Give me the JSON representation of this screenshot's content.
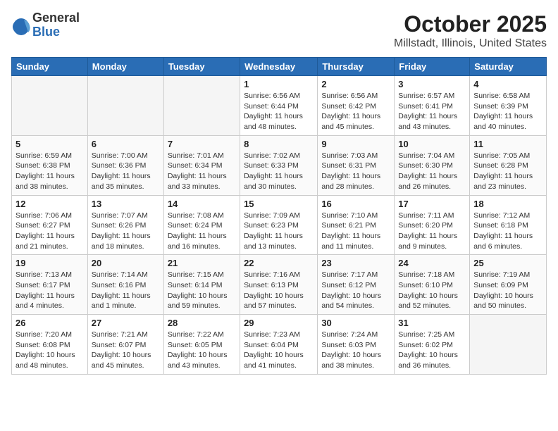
{
  "logo": {
    "general": "General",
    "blue": "Blue"
  },
  "title": "October 2025",
  "location": "Millstadt, Illinois, United States",
  "days_of_week": [
    "Sunday",
    "Monday",
    "Tuesday",
    "Wednesday",
    "Thursday",
    "Friday",
    "Saturday"
  ],
  "weeks": [
    [
      {
        "day": "",
        "info": ""
      },
      {
        "day": "",
        "info": ""
      },
      {
        "day": "",
        "info": ""
      },
      {
        "day": "1",
        "info": "Sunrise: 6:56 AM\nSunset: 6:44 PM\nDaylight: 11 hours\nand 48 minutes."
      },
      {
        "day": "2",
        "info": "Sunrise: 6:56 AM\nSunset: 6:42 PM\nDaylight: 11 hours\nand 45 minutes."
      },
      {
        "day": "3",
        "info": "Sunrise: 6:57 AM\nSunset: 6:41 PM\nDaylight: 11 hours\nand 43 minutes."
      },
      {
        "day": "4",
        "info": "Sunrise: 6:58 AM\nSunset: 6:39 PM\nDaylight: 11 hours\nand 40 minutes."
      }
    ],
    [
      {
        "day": "5",
        "info": "Sunrise: 6:59 AM\nSunset: 6:38 PM\nDaylight: 11 hours\nand 38 minutes."
      },
      {
        "day": "6",
        "info": "Sunrise: 7:00 AM\nSunset: 6:36 PM\nDaylight: 11 hours\nand 35 minutes."
      },
      {
        "day": "7",
        "info": "Sunrise: 7:01 AM\nSunset: 6:34 PM\nDaylight: 11 hours\nand 33 minutes."
      },
      {
        "day": "8",
        "info": "Sunrise: 7:02 AM\nSunset: 6:33 PM\nDaylight: 11 hours\nand 30 minutes."
      },
      {
        "day": "9",
        "info": "Sunrise: 7:03 AM\nSunset: 6:31 PM\nDaylight: 11 hours\nand 28 minutes."
      },
      {
        "day": "10",
        "info": "Sunrise: 7:04 AM\nSunset: 6:30 PM\nDaylight: 11 hours\nand 26 minutes."
      },
      {
        "day": "11",
        "info": "Sunrise: 7:05 AM\nSunset: 6:28 PM\nDaylight: 11 hours\nand 23 minutes."
      }
    ],
    [
      {
        "day": "12",
        "info": "Sunrise: 7:06 AM\nSunset: 6:27 PM\nDaylight: 11 hours\nand 21 minutes."
      },
      {
        "day": "13",
        "info": "Sunrise: 7:07 AM\nSunset: 6:26 PM\nDaylight: 11 hours\nand 18 minutes."
      },
      {
        "day": "14",
        "info": "Sunrise: 7:08 AM\nSunset: 6:24 PM\nDaylight: 11 hours\nand 16 minutes."
      },
      {
        "day": "15",
        "info": "Sunrise: 7:09 AM\nSunset: 6:23 PM\nDaylight: 11 hours\nand 13 minutes."
      },
      {
        "day": "16",
        "info": "Sunrise: 7:10 AM\nSunset: 6:21 PM\nDaylight: 11 hours\nand 11 minutes."
      },
      {
        "day": "17",
        "info": "Sunrise: 7:11 AM\nSunset: 6:20 PM\nDaylight: 11 hours\nand 9 minutes."
      },
      {
        "day": "18",
        "info": "Sunrise: 7:12 AM\nSunset: 6:18 PM\nDaylight: 11 hours\nand 6 minutes."
      }
    ],
    [
      {
        "day": "19",
        "info": "Sunrise: 7:13 AM\nSunset: 6:17 PM\nDaylight: 11 hours\nand 4 minutes."
      },
      {
        "day": "20",
        "info": "Sunrise: 7:14 AM\nSunset: 6:16 PM\nDaylight: 11 hours\nand 1 minute."
      },
      {
        "day": "21",
        "info": "Sunrise: 7:15 AM\nSunset: 6:14 PM\nDaylight: 10 hours\nand 59 minutes."
      },
      {
        "day": "22",
        "info": "Sunrise: 7:16 AM\nSunset: 6:13 PM\nDaylight: 10 hours\nand 57 minutes."
      },
      {
        "day": "23",
        "info": "Sunrise: 7:17 AM\nSunset: 6:12 PM\nDaylight: 10 hours\nand 54 minutes."
      },
      {
        "day": "24",
        "info": "Sunrise: 7:18 AM\nSunset: 6:10 PM\nDaylight: 10 hours\nand 52 minutes."
      },
      {
        "day": "25",
        "info": "Sunrise: 7:19 AM\nSunset: 6:09 PM\nDaylight: 10 hours\nand 50 minutes."
      }
    ],
    [
      {
        "day": "26",
        "info": "Sunrise: 7:20 AM\nSunset: 6:08 PM\nDaylight: 10 hours\nand 48 minutes."
      },
      {
        "day": "27",
        "info": "Sunrise: 7:21 AM\nSunset: 6:07 PM\nDaylight: 10 hours\nand 45 minutes."
      },
      {
        "day": "28",
        "info": "Sunrise: 7:22 AM\nSunset: 6:05 PM\nDaylight: 10 hours\nand 43 minutes."
      },
      {
        "day": "29",
        "info": "Sunrise: 7:23 AM\nSunset: 6:04 PM\nDaylight: 10 hours\nand 41 minutes."
      },
      {
        "day": "30",
        "info": "Sunrise: 7:24 AM\nSunset: 6:03 PM\nDaylight: 10 hours\nand 38 minutes."
      },
      {
        "day": "31",
        "info": "Sunrise: 7:25 AM\nSunset: 6:02 PM\nDaylight: 10 hours\nand 36 minutes."
      },
      {
        "day": "",
        "info": ""
      }
    ]
  ]
}
